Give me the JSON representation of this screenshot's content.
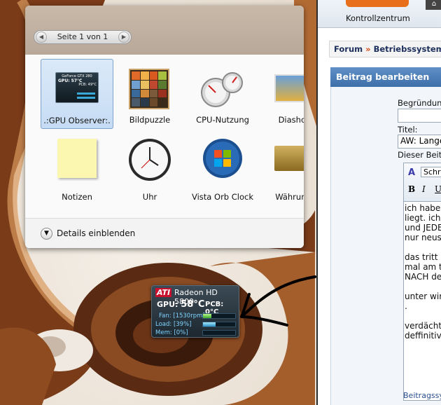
{
  "gallery": {
    "pager_label": "Seite 1 von 1",
    "details_label": "Details einblenden",
    "items": [
      {
        "name": ".:GPU Observer:."
      },
      {
        "name": "Bildpuzzle"
      },
      {
        "name": "CPU-Nutzung"
      },
      {
        "name": "Diashow"
      },
      {
        "name": "Notizen"
      },
      {
        "name": "Uhr"
      },
      {
        "name": "Vista Orb Clock"
      },
      {
        "name": "Währungs"
      }
    ],
    "gpu_observer_thumb": {
      "card": "GeForce GTX 280",
      "gpu": "GPU: 57°C",
      "pcb": "PCB: 49°C"
    }
  },
  "ati_gadget": {
    "brand": "ATI",
    "model": "Radeon HD 5800",
    "gpu_label": "GPU:",
    "gpu_temp": "58°C",
    "pcb": "PCB: 0°C",
    "fan": "Fan: [1530rpm]",
    "load": "Load: [39%]",
    "mem": "Mem: [0%]",
    "fan_level": 0.25,
    "load_level": 0.39,
    "mem_level": 0.0
  },
  "browser": {
    "control_center": "Kontrollzentrum",
    "breadcrumb_forum": "Forum",
    "breadcrumb_sep": "»",
    "breadcrumb_section": "Betriebssysteme",
    "edit_title": "Beitrag bearbeiten",
    "reason_label": "Begründung",
    "title_label": "Titel:",
    "title_value": "AW: Lange",
    "post_label": "Dieser Beitr",
    "font_button": "Schr",
    "body_text": "ich habe\nliegt. ich\nund JEDE\nnur neus\n\ndas tritt\nmal am t\nNACH de\n\nunter wir\n.\n\nverdächt\ndeffinitiv",
    "footer_link": "Beitragssym"
  }
}
